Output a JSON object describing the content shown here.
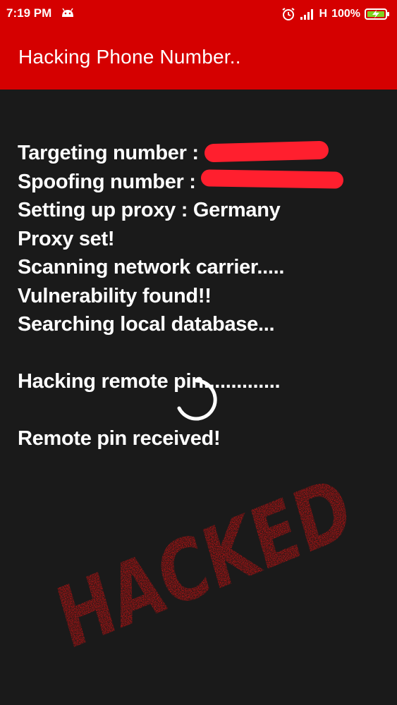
{
  "status_bar": {
    "time": "7:19 PM",
    "network_type": "H",
    "battery": "100%",
    "icons": [
      "android-notification-icon",
      "alarm-icon",
      "signal-icon",
      "battery-charging-icon"
    ]
  },
  "app_bar": {
    "title": "Hacking Phone Number.."
  },
  "log": {
    "lines": [
      "Targeting number : ",
      "Spoofing number : ",
      "Setting up proxy : Germany",
      "Proxy set!",
      "Scanning network carrier.....",
      "Vulnerability found!!",
      "Searching local database...",
      "",
      "Hacking remote pin..............",
      "",
      "Remote pin received!"
    ]
  },
  "stamp": {
    "text": "HACKED",
    "color": "#e01010"
  },
  "colors": {
    "accent": "#d50000",
    "background": "#1a1a1a",
    "text": "#ffffff",
    "redaction": "#ff1f2e"
  }
}
